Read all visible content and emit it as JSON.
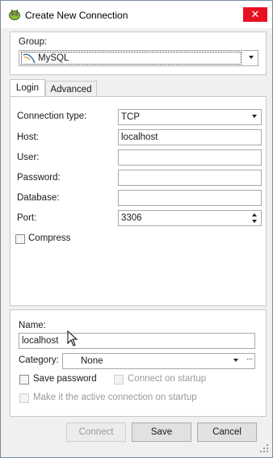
{
  "window": {
    "title": "Create New Connection",
    "close_glyph": "✕"
  },
  "group": {
    "label": "Group:",
    "value": "MySQL"
  },
  "tabs": [
    {
      "label": "Login"
    },
    {
      "label": "Advanced"
    }
  ],
  "login": {
    "connection_type_label": "Connection type:",
    "connection_type_value": "TCP",
    "host_label": "Host:",
    "host_value": "localhost",
    "user_label": "User:",
    "user_value": "",
    "password_label": "Password:",
    "password_value": "",
    "database_label": "Database:",
    "database_value": "",
    "port_label": "Port:",
    "port_value": "3306",
    "compress_label": "Compress"
  },
  "bottom": {
    "name_label": "Name:",
    "name_value": "localhost",
    "category_label": "Category:",
    "category_value": "None",
    "category_more": "···",
    "save_password_label": "Save password",
    "connect_on_startup_label": "Connect on startup",
    "active_connection_label": "Make it the active connection on startup"
  },
  "buttons": {
    "connect": "Connect",
    "save": "Save",
    "cancel": "Cancel"
  },
  "colors": {
    "close_red": "#e81123",
    "tab_border": "#c8c8c8",
    "disabled_text": "#9a9a9a"
  },
  "icons": {
    "app": "database-creature-icon",
    "group_mysql": "mysql-dolphin-icon"
  }
}
